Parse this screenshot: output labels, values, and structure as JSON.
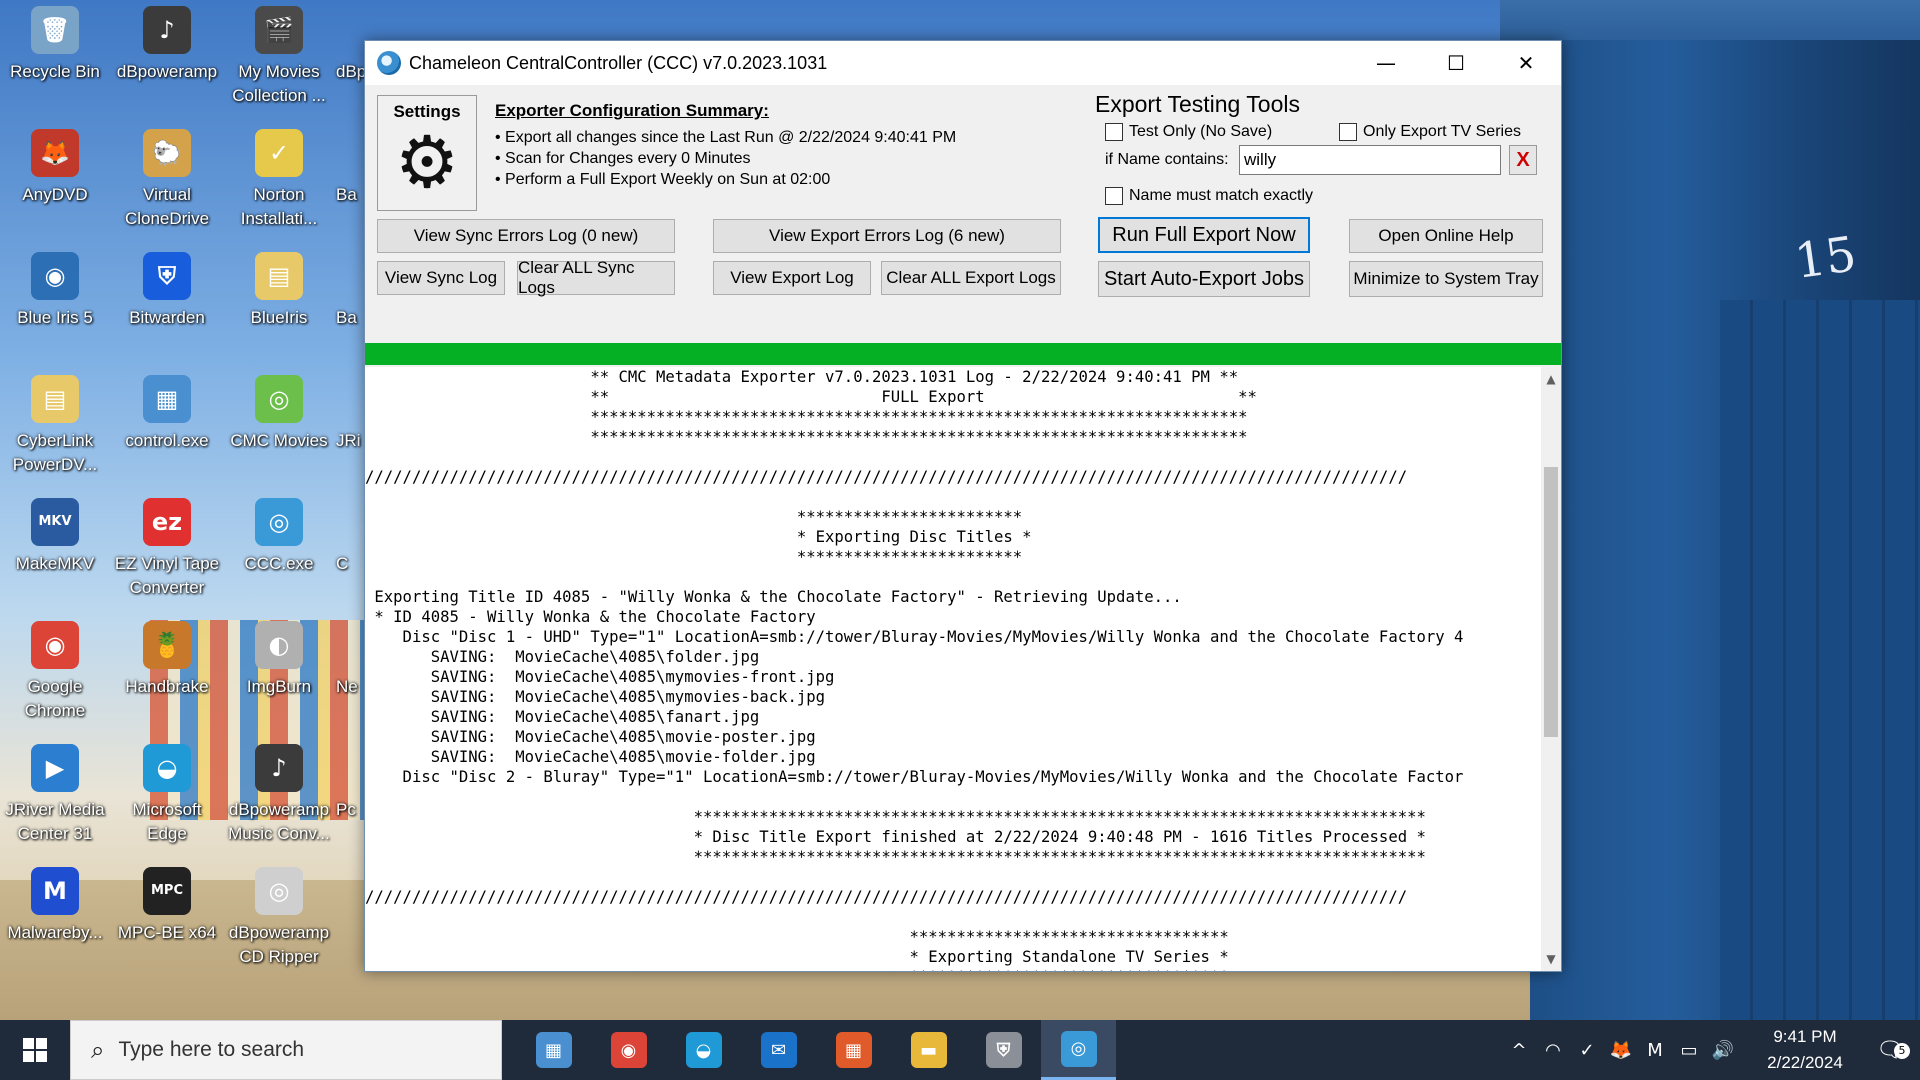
{
  "desktop": {
    "icons": [
      {
        "label": "Recycle Bin",
        "glyph": "🗑",
        "color": "#7aa3c8"
      },
      {
        "label": "dBpoweramp",
        "glyph": "♪",
        "color": "#3b3b3b"
      },
      {
        "label": "My Movies Collection ...",
        "glyph": "🎬",
        "color": "#4a4a4a"
      },
      {
        "label": "AnyDVD",
        "glyph": "🦊",
        "color": "#c0392b"
      },
      {
        "label": "Virtual CloneDrive",
        "glyph": "🐑",
        "color": "#d4a24a"
      },
      {
        "label": "Norton Installati...",
        "glyph": "✓",
        "color": "#e6c84a"
      },
      {
        "label": "Blue Iris 5",
        "glyph": "◉",
        "color": "#2c6fb5"
      },
      {
        "label": "Bitwarden",
        "glyph": "⛨",
        "color": "#175ddc"
      },
      {
        "label": "BlueIris",
        "glyph": "▤",
        "color": "#e8c96a"
      },
      {
        "label": "CyberLink PowerDV...",
        "glyph": "▤",
        "color": "#e8c96a"
      },
      {
        "label": "control.exe",
        "glyph": "▦",
        "color": "#4a8fd0"
      },
      {
        "label": "CMC Movies",
        "glyph": "◎",
        "color": "#6bbf4a"
      },
      {
        "label": "MakeMKV",
        "glyph": "MKV",
        "color": "#2a5aa0"
      },
      {
        "label": "EZ Vinyl Tape Converter",
        "glyph": "ez",
        "color": "#e03030"
      },
      {
        "label": "CCC.exe",
        "glyph": "◎",
        "color": "#3a9ad8"
      },
      {
        "label": "Google Chrome",
        "glyph": "◉",
        "color": "#db4437"
      },
      {
        "label": "Handbrake",
        "glyph": "🍍",
        "color": "#c8782a"
      },
      {
        "label": "ImgBurn",
        "glyph": "◐",
        "color": "#b0b0b0"
      },
      {
        "label": "JRiver Media Center 31",
        "glyph": "▶",
        "color": "#2c7fd0"
      },
      {
        "label": "Microsoft Edge",
        "glyph": "◒",
        "color": "#1f9ad6"
      },
      {
        "label": "dBpoweramp Music Conv...",
        "glyph": "♪",
        "color": "#3b3b3b"
      },
      {
        "label": "Malwareby...",
        "glyph": "M",
        "color": "#1f4fd0"
      },
      {
        "label": "MPC-BE x64",
        "glyph": "MPC",
        "color": "#222222"
      },
      {
        "label": "dBpoweramp CD Ripper",
        "glyph": "◎",
        "color": "#cfcfcf"
      }
    ],
    "partial_icons": [
      "dBp",
      "Ba",
      "Ba",
      "JRi",
      "C",
      "Ne",
      "Pc"
    ],
    "hut_number": "15"
  },
  "window": {
    "title": "Chameleon CentralController (CCC) v7.0.2023.1031",
    "minimize": "—",
    "maximize": "☐",
    "close": "✕"
  },
  "settings": {
    "label": "Settings",
    "icon": "⚙"
  },
  "summary": {
    "header": "Exporter Configuration Summary:",
    "lines": [
      "• Export all changes since the Last Run @ 2/22/2024 9:40:41 PM",
      "• Scan for Changes every 0 Minutes",
      "• Perform a Full Export Weekly on Sun at 02:00"
    ]
  },
  "testing": {
    "header": "Export Testing Tools",
    "test_only": "Test Only (No Save)",
    "only_tv": "Only Export TV Series",
    "name_label": "if Name contains:",
    "name_value": "willy",
    "clear": "X",
    "exact": "Name must match exactly"
  },
  "buttons": {
    "sync_errors": "View Sync Errors Log (0 new)",
    "export_errors": "View Export Errors Log (6 new)",
    "run_full": "Run Full Export Now",
    "help": "Open Online Help",
    "sync_log": "View Sync Log",
    "clear_sync": "Clear ALL Sync Logs",
    "export_log": "View Export Log",
    "clear_export": "Clear ALL Export Logs",
    "auto_export": "Start Auto-Export Jobs",
    "minimize_tray": "Minimize to System Tray"
  },
  "progress": {
    "value": 1.0,
    "color": "#06b025"
  },
  "log": [
    "                        ** CMC Metadata Exporter v7.0.2023.1031 Log - 2/22/2024 9:40:41 PM **",
    "                        **                             FULL Export                           **",
    "                        **********************************************************************",
    "                        **********************************************************************",
    "",
    "///////////////////////////////////////////////////////////////////////////////////////////////////////////////",
    "",
    "                                              ************************",
    "                                              * Exporting Disc Titles *",
    "                                              ************************",
    "",
    " Exporting Title ID 4085 - \"Willy Wonka & the Chocolate Factory\" - Retrieving Update...",
    " * ID 4085 - Willy Wonka & the Chocolate Factory",
    "    Disc \"Disc 1 - UHD\" Type=\"1\" LocationA=smb://tower/Bluray-Movies/MyMovies/Willy Wonka and the Chocolate Factory 4",
    "       SAVING:  MovieCache\\4085\\folder.jpg",
    "       SAVING:  MovieCache\\4085\\mymovies-front.jpg",
    "       SAVING:  MovieCache\\4085\\mymovies-back.jpg",
    "       SAVING:  MovieCache\\4085\\fanart.jpg",
    "       SAVING:  MovieCache\\4085\\movie-poster.jpg",
    "       SAVING:  MovieCache\\4085\\movie-folder.jpg",
    "    Disc \"Disc 2 - Bluray\" Type=\"1\" LocationA=smb://tower/Bluray-Movies/MyMovies/Willy Wonka and the Chocolate Factor",
    "",
    "                                   ******************************************************************************",
    "                                   * Disc Title Export finished at 2/22/2024 9:40:48 PM - 1616 Titles Processed *",
    "                                   ******************************************************************************",
    "",
    "///////////////////////////////////////////////////////////////////////////////////////////////////////////////",
    "",
    "                                                          **********************************",
    "                                                          * Exporting Standalone TV Series *",
    "                                                          **********************************"
  ],
  "taskbar": {
    "search_placeholder": "Type here to search",
    "apps": [
      {
        "name": "control-panel",
        "glyph": "▦",
        "color": "#4a8fd0"
      },
      {
        "name": "chrome",
        "glyph": "◉",
        "color": "#db4437"
      },
      {
        "name": "edge",
        "glyph": "◒",
        "color": "#1f9ad6"
      },
      {
        "name": "mail",
        "glyph": "✉",
        "color": "#1a73c8"
      },
      {
        "name": "store",
        "glyph": "▦",
        "color": "#e05a2a"
      },
      {
        "name": "file-explorer",
        "glyph": "▬",
        "color": "#e8b83a"
      },
      {
        "name": "bitwarden",
        "glyph": "⛨",
        "color": "#8a8f98"
      },
      {
        "name": "ccc",
        "glyph": "◎",
        "color": "#3a9ad8"
      }
    ],
    "tray": [
      "^",
      "◠",
      "✓",
      "🦊",
      "M",
      "▭",
      "🔊"
    ],
    "time": "9:41 PM",
    "date": "2/22/2024",
    "notifications": "5"
  }
}
